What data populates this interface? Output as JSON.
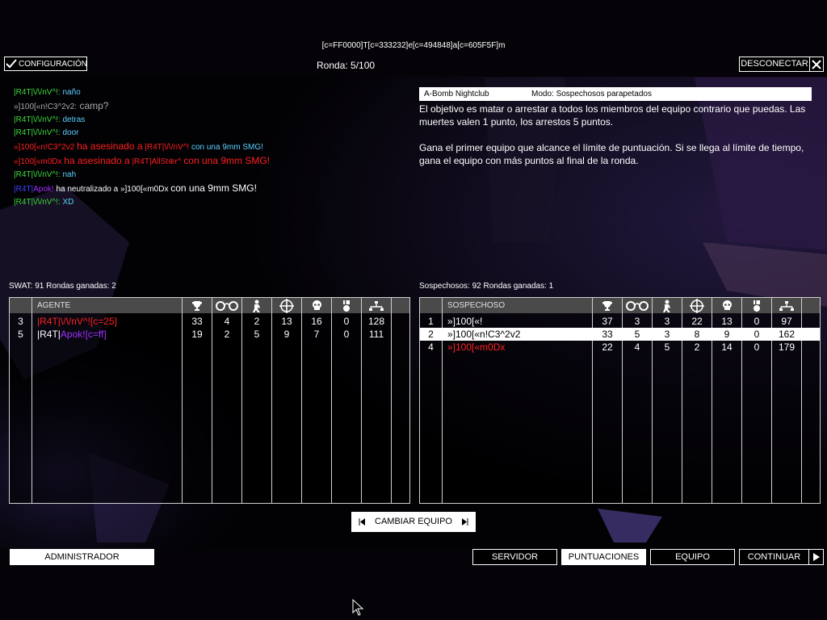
{
  "window_title": "[c=FF0000]T[c=333232]e[c=494848]a[c=605F5F]m",
  "round_label": "Ronda: 5/100",
  "config_label": "CONFIGURACIÓN",
  "disconnect_label": "DESCONECTAR",
  "chat": [
    {
      "who": "|R4T|\\/\\/nV^!:",
      "msg": "naño"
    },
    {
      "who": "»]100[«n!C3^2v2:",
      "msg": "camp?"
    },
    {
      "who": "|R4T|\\/\\/nV^!:",
      "msg": "detras"
    },
    {
      "who": "|R4T|\\/\\/nV^!:",
      "msg": "door"
    },
    {
      "a": "»]100[«n!C3^2v2",
      "mid": "ha asesinado a",
      "b": "|R4T|\\/\\/nV^!",
      "end": "con una 9mm SMG!"
    },
    {
      "a": "»]100[«m0Dx",
      "mid": "ha asesinado a",
      "b": "|R4T|AllSt⊕r^",
      "end": "con una 9mm SMG!"
    },
    {
      "who": "|R4T|\\/\\/nV^!:",
      "msg": "nah"
    },
    {
      "a1": "|R4T|",
      "a2": "Apok!",
      "mid": "ha neutralizado a",
      "b": "»]100[«m0Dx",
      "end": "con una 9mm SMG!"
    },
    {
      "who": "|R4T|\\/\\/nV^!:",
      "msg": "XD"
    }
  ],
  "info": {
    "map": "A-Bomb Nightclub",
    "mode": "Modo: Sospechosos parapetados",
    "p1": "El objetivo es matar o arrestar a todos los miembros del equipo contrario que puedas. Las muertes valen 1 punto, los arrestos 5 puntos.",
    "p2": "Gana el primer equipo que alcance el límite de puntuación. Si se llega al límite de tiempo, gana el equipo con más puntos al final de la ronda."
  },
  "swat": {
    "title": "SWAT: 91 Rondas ganadas: 2",
    "header": "AGENTE",
    "rows": [
      {
        "num": "3",
        "name_a": "|R4T|\\/\\/nV^!",
        "name_b": "[c=25]",
        "cols": [
          "33",
          "4",
          "2",
          "13",
          "16",
          "0",
          "128"
        ]
      },
      {
        "num": "5",
        "name_a": "|R4T|",
        "name_b": "Apok![c=ff]",
        "cols": [
          "19",
          "2",
          "5",
          "9",
          "7",
          "0",
          "111"
        ]
      }
    ]
  },
  "suspects": {
    "title": "Sospechosos: 92 Rondas ganadas: 1",
    "header": "SOSPECHOSO",
    "rows": [
      {
        "num": "1",
        "name": "»]100[«!",
        "cols": [
          "37",
          "3",
          "3",
          "22",
          "13",
          "0",
          "97"
        ]
      },
      {
        "num": "2",
        "name": "»]100[«n!C3^2v2",
        "cols": [
          "33",
          "5",
          "3",
          "8",
          "9",
          "0",
          "162"
        ]
      },
      {
        "num": "4",
        "name": "»]100[«m0Dx",
        "cols": [
          "22",
          "4",
          "5",
          "2",
          "14",
          "0",
          "179"
        ]
      }
    ]
  },
  "icons": [
    "trophy-icon",
    "handcuffs-icon",
    "arrest-icon",
    "crosshair-icon",
    "skull-icon",
    "medal-icon",
    "network-icon"
  ],
  "change_team_label": "CAMBIAR EQUIPO",
  "admin_label": "ADMINISTRADOR",
  "tabs": {
    "server": "SERVIDOR",
    "scores": "PUNTUACIONES",
    "team": "EQUIPO",
    "continue": "CONTINUAR"
  },
  "colors": {
    "green": "#3cdc3c",
    "cyan": "#5ad2ff",
    "red": "#ff2020",
    "purple": "#a030ff",
    "header_bg": "#4a4a4a"
  }
}
